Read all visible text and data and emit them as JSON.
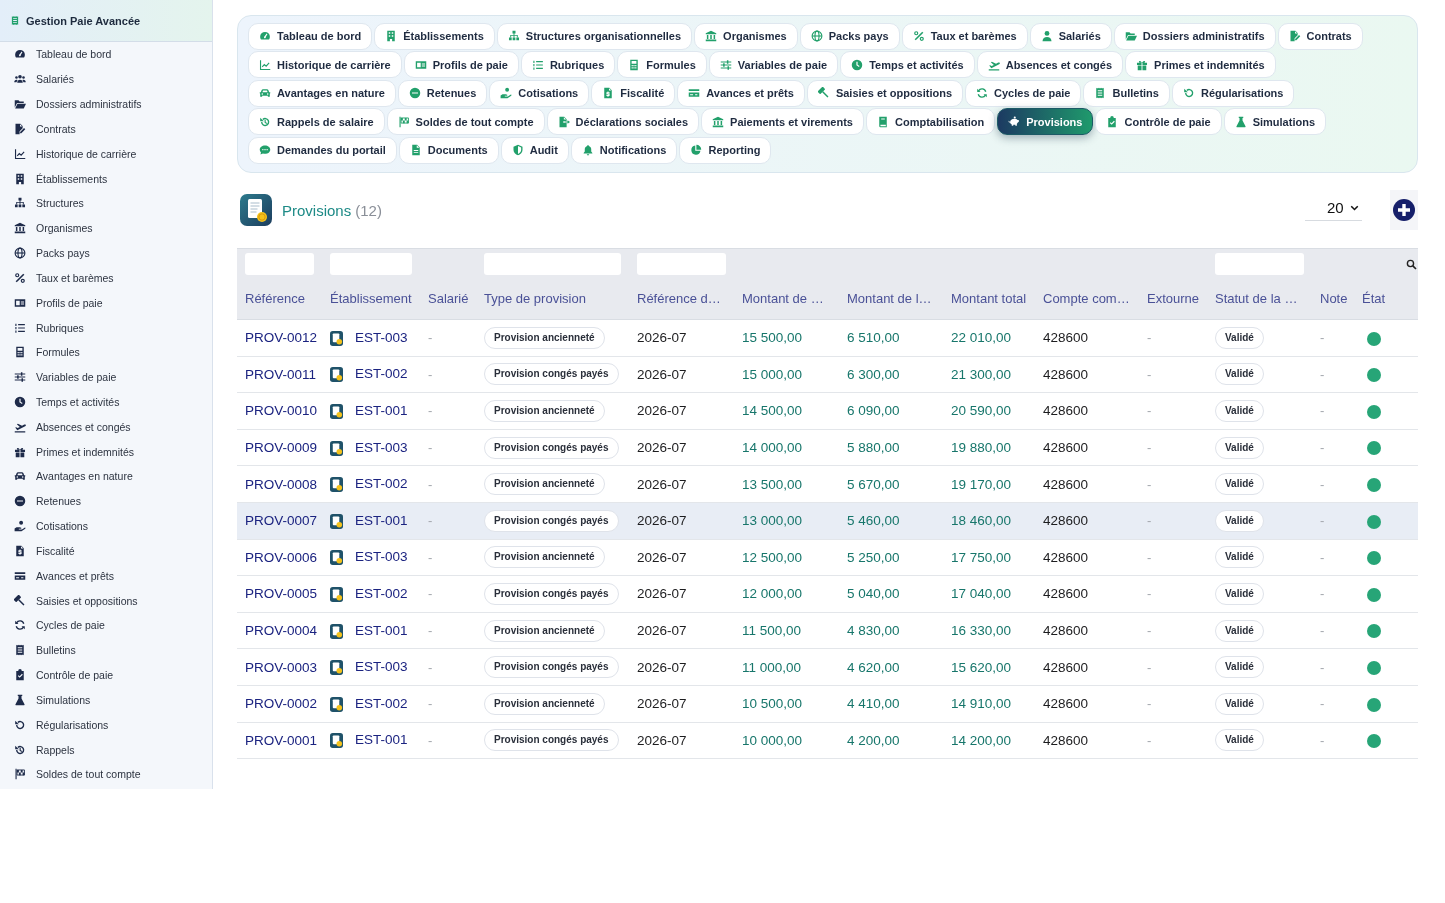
{
  "sidebar": {
    "title": "Gestion Paie Avancée",
    "items": [
      {
        "label": "Tableau de bord"
      },
      {
        "label": "Salariés"
      },
      {
        "label": "Dossiers administratifs"
      },
      {
        "label": "Contrats"
      },
      {
        "label": "Historique de carrière"
      },
      {
        "label": "Établissements"
      },
      {
        "label": "Structures"
      },
      {
        "label": "Organismes"
      },
      {
        "label": "Packs pays"
      },
      {
        "label": "Taux et barèmes"
      },
      {
        "label": "Profils de paie"
      },
      {
        "label": "Rubriques"
      },
      {
        "label": "Formules"
      },
      {
        "label": "Variables de paie"
      },
      {
        "label": "Temps et activités"
      },
      {
        "label": "Absences et congés"
      },
      {
        "label": "Primes et indemnités"
      },
      {
        "label": "Avantages en nature"
      },
      {
        "label": "Retenues"
      },
      {
        "label": "Cotisations"
      },
      {
        "label": "Fiscalité"
      },
      {
        "label": "Avances et prêts"
      },
      {
        "label": "Saisies et oppositions"
      },
      {
        "label": "Cycles de paie"
      },
      {
        "label": "Bulletins"
      },
      {
        "label": "Contrôle de paie"
      },
      {
        "label": "Simulations"
      },
      {
        "label": "Régularisations"
      },
      {
        "label": "Rappels"
      },
      {
        "label": "Soldes de tout compte"
      }
    ]
  },
  "tabs": [
    {
      "label": "Tableau de bord",
      "selected": false
    },
    {
      "label": "Établissements",
      "selected": false
    },
    {
      "label": "Structures organisationnelles",
      "selected": false
    },
    {
      "label": "Organismes",
      "selected": false
    },
    {
      "label": "Packs pays",
      "selected": false
    },
    {
      "label": "Taux et barèmes",
      "selected": false
    },
    {
      "label": "Salariés",
      "selected": false
    },
    {
      "label": "Dossiers administratifs",
      "selected": false
    },
    {
      "label": "Contrats",
      "selected": false
    },
    {
      "label": "Historique de carrière",
      "selected": false
    },
    {
      "label": "Profils de paie",
      "selected": false
    },
    {
      "label": "Rubriques",
      "selected": false
    },
    {
      "label": "Formules",
      "selected": false
    },
    {
      "label": "Variables de paie",
      "selected": false
    },
    {
      "label": "Temps et activités",
      "selected": false
    },
    {
      "label": "Absences et congés",
      "selected": false
    },
    {
      "label": "Primes et indemnités",
      "selected": false
    },
    {
      "label": "Avantages en nature",
      "selected": false
    },
    {
      "label": "Retenues",
      "selected": false
    },
    {
      "label": "Cotisations",
      "selected": false
    },
    {
      "label": "Fiscalité",
      "selected": false
    },
    {
      "label": "Avances et prêts",
      "selected": false
    },
    {
      "label": "Saisies et oppositions",
      "selected": false
    },
    {
      "label": "Cycles de paie",
      "selected": false
    },
    {
      "label": "Bulletins",
      "selected": false
    },
    {
      "label": "Régularisations",
      "selected": false
    },
    {
      "label": "Rappels de salaire",
      "selected": false
    },
    {
      "label": "Soldes de tout compte",
      "selected": false
    },
    {
      "label": "Déclarations sociales",
      "selected": false
    },
    {
      "label": "Paiements et virements",
      "selected": false
    },
    {
      "label": "Comptabilisation",
      "selected": false
    },
    {
      "label": "Provisions",
      "selected": true
    },
    {
      "label": "Contrôle de paie",
      "selected": false
    },
    {
      "label": "Simulations",
      "selected": false
    },
    {
      "label": "Demandes du portail",
      "selected": false
    },
    {
      "label": "Documents",
      "selected": false
    },
    {
      "label": "Audit",
      "selected": false
    },
    {
      "label": "Notifications",
      "selected": false
    },
    {
      "label": "Reporting",
      "selected": false
    }
  ],
  "page_header": {
    "title": "Provisions",
    "count": "(12)",
    "page_size": "20"
  },
  "table": {
    "columns": [
      {
        "label": "Référence",
        "kind": "link",
        "filter": true
      },
      {
        "label": "Établissement",
        "kind": "establishment",
        "filter": true
      },
      {
        "label": "Salarié",
        "kind": "muted",
        "filter": false
      },
      {
        "label": "Type de provision",
        "kind": "tag",
        "filter": true
      },
      {
        "label": "Référence d…",
        "kind": "text",
        "filter": true
      },
      {
        "label": "Montant de …",
        "kind": "amount",
        "filter": false
      },
      {
        "label": "Montant de l…",
        "kind": "amount",
        "filter": false
      },
      {
        "label": "Montant total",
        "kind": "amount",
        "filter": false
      },
      {
        "label": "Compte com…",
        "kind": "text",
        "filter": false
      },
      {
        "label": "Extourne",
        "kind": "muted",
        "filter": false
      },
      {
        "label": "Statut de la …",
        "kind": "status",
        "filter": true
      },
      {
        "label": "Note",
        "kind": "muted",
        "filter": false
      },
      {
        "label": "État",
        "kind": "dot",
        "filter": false
      }
    ],
    "rows": [
      {
        "selected": false,
        "color": "#27a577",
        "cells": [
          "PROV-0012",
          "EST-003",
          "-",
          "Provision ancienneté",
          "2026-07",
          "15 500,00",
          "6 510,00",
          "22 010,00",
          "428600",
          "-",
          "Validé",
          "-"
        ]
      },
      {
        "selected": false,
        "color": "#27a577",
        "cells": [
          "PROV-0011",
          "EST-002",
          "-",
          "Provision congés payés",
          "2026-07",
          "15 000,00",
          "6 300,00",
          "21 300,00",
          "428600",
          "-",
          "Validé",
          "-"
        ]
      },
      {
        "selected": false,
        "color": "#27a577",
        "cells": [
          "PROV-0010",
          "EST-001",
          "-",
          "Provision ancienneté",
          "2026-07",
          "14 500,00",
          "6 090,00",
          "20 590,00",
          "428600",
          "-",
          "Validé",
          "-"
        ]
      },
      {
        "selected": false,
        "color": "#27a577",
        "cells": [
          "PROV-0009",
          "EST-003",
          "-",
          "Provision congés payés",
          "2026-07",
          "14 000,00",
          "5 880,00",
          "19 880,00",
          "428600",
          "-",
          "Validé",
          "-"
        ]
      },
      {
        "selected": false,
        "color": "#27a577",
        "cells": [
          "PROV-0008",
          "EST-002",
          "-",
          "Provision ancienneté",
          "2026-07",
          "13 500,00",
          "5 670,00",
          "19 170,00",
          "428600",
          "-",
          "Validé",
          "-"
        ]
      },
      {
        "selected": true,
        "color": "#27a577",
        "cells": [
          "PROV-0007",
          "EST-001",
          "-",
          "Provision congés payés",
          "2026-07",
          "13 000,00",
          "5 460,00",
          "18 460,00",
          "428600",
          "-",
          "Validé",
          "-"
        ]
      },
      {
        "selected": false,
        "color": "#27a577",
        "cells": [
          "PROV-0006",
          "EST-003",
          "-",
          "Provision ancienneté",
          "2026-07",
          "12 500,00",
          "5 250,00",
          "17 750,00",
          "428600",
          "-",
          "Validé",
          "-"
        ]
      },
      {
        "selected": false,
        "color": "#27a577",
        "cells": [
          "PROV-0005",
          "EST-002",
          "-",
          "Provision congés payés",
          "2026-07",
          "12 000,00",
          "5 040,00",
          "17 040,00",
          "428600",
          "-",
          "Validé",
          "-"
        ]
      },
      {
        "selected": false,
        "color": "#27a577",
        "cells": [
          "PROV-0004",
          "EST-001",
          "-",
          "Provision ancienneté",
          "2026-07",
          "11 500,00",
          "4 830,00",
          "16 330,00",
          "428600",
          "-",
          "Validé",
          "-"
        ]
      },
      {
        "selected": false,
        "color": "#27a577",
        "cells": [
          "PROV-0003",
          "EST-003",
          "-",
          "Provision congés payés",
          "2026-07",
          "11 000,00",
          "4 620,00",
          "15 620,00",
          "428600",
          "-",
          "Validé",
          "-"
        ]
      },
      {
        "selected": false,
        "color": "#27a577",
        "cells": [
          "PROV-0002",
          "EST-002",
          "-",
          "Provision ancienneté",
          "2026-07",
          "10 500,00",
          "4 410,00",
          "14 910,00",
          "428600",
          "-",
          "Validé",
          "-"
        ]
      },
      {
        "selected": false,
        "color": "#27a577",
        "cells": [
          "PROV-0001",
          "EST-001",
          "-",
          "Provision congés payés",
          "2026-07",
          "10 000,00",
          "4 200,00",
          "14 200,00",
          "428600",
          "-",
          "Validé",
          "-"
        ]
      }
    ]
  }
}
